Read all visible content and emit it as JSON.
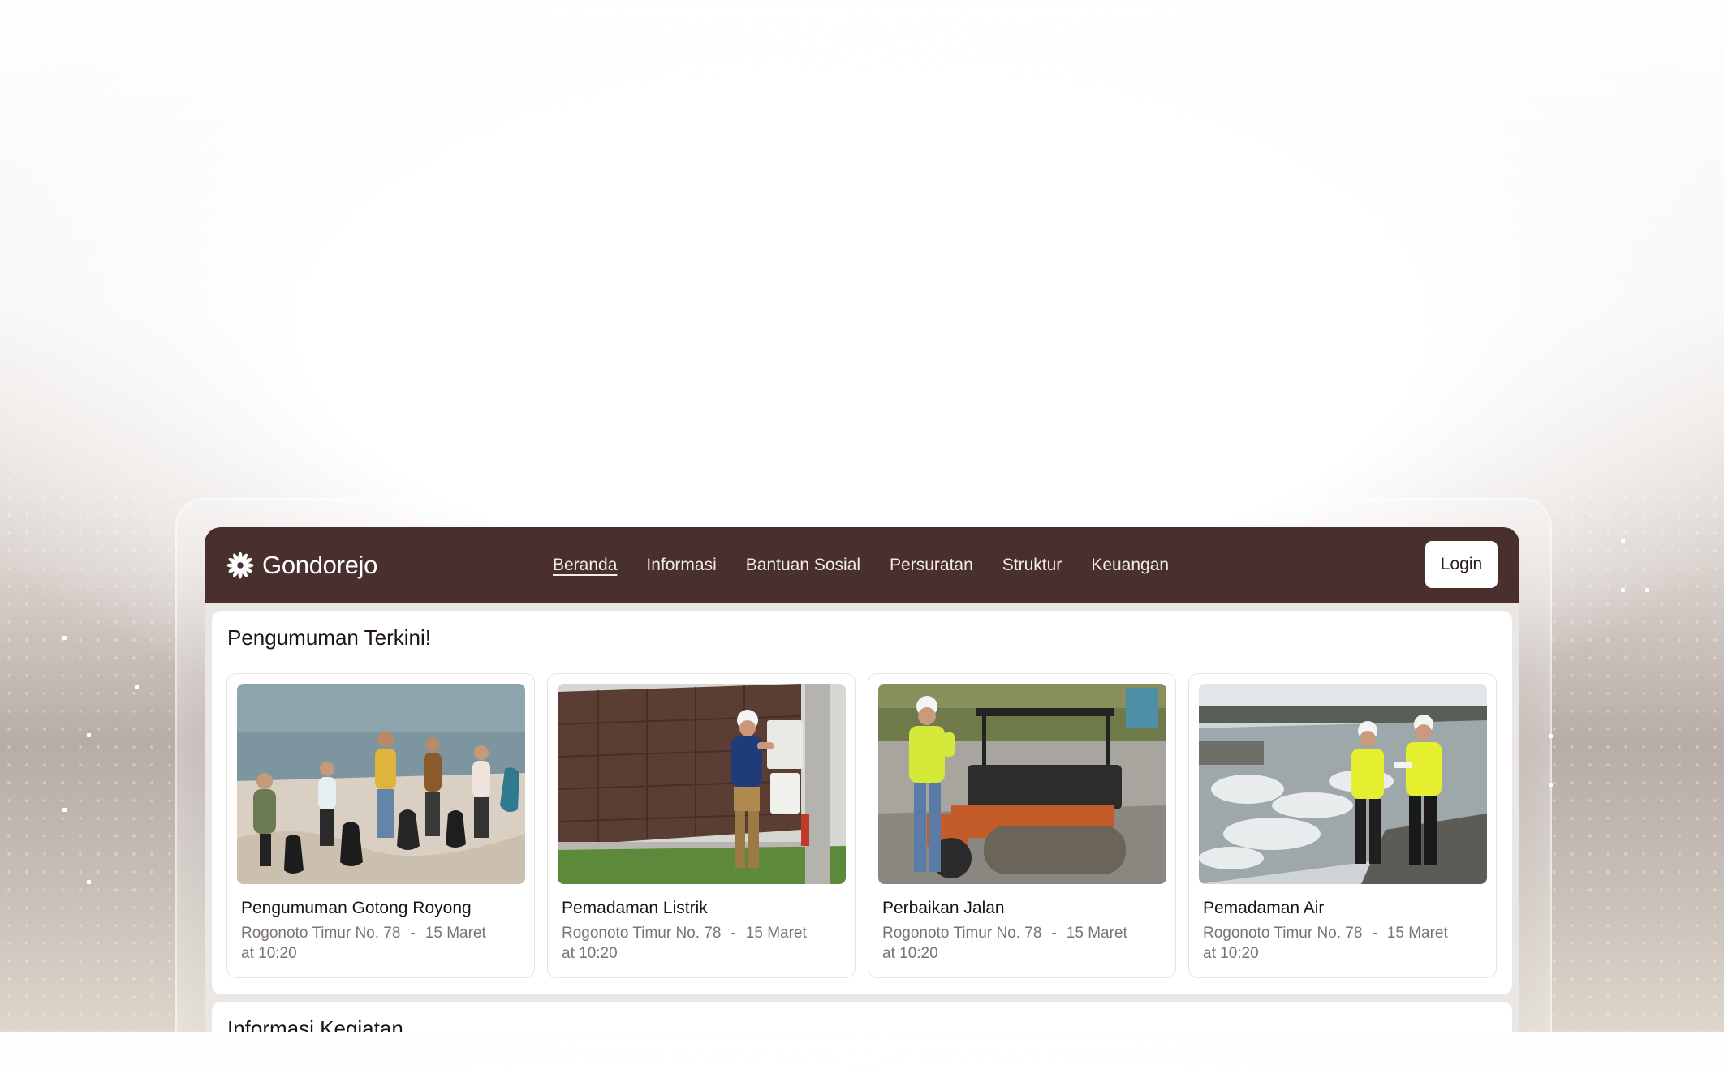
{
  "brand": {
    "name": "Gondorejo",
    "icon": "flower-logo-icon"
  },
  "nav": {
    "items": [
      {
        "label": "Beranda",
        "active": true
      },
      {
        "label": "Informasi",
        "active": false
      },
      {
        "label": "Bantuan Sosial",
        "active": false
      },
      {
        "label": "Persuratan",
        "active": false
      },
      {
        "label": "Struktur",
        "active": false
      },
      {
        "label": "Keuangan",
        "active": false
      }
    ],
    "login_label": "Login"
  },
  "announcements": {
    "title": "Pengumuman Terkini!",
    "cards": [
      {
        "title": "Pengumuman Gotong Royong",
        "location": "Rogonoto Timur No. 78",
        "separator": "-",
        "date": "15 Maret",
        "time": "at 10:20",
        "image": "beach-cleanup-photo"
      },
      {
        "title": "Pemadaman Listrik",
        "location": "Rogonoto Timur No. 78",
        "separator": "-",
        "date": "15 Maret",
        "time": "at 10:20",
        "image": "electrician-photo"
      },
      {
        "title": "Perbaikan Jalan",
        "location": "Rogonoto Timur No. 78",
        "separator": "-",
        "date": "15 Maret",
        "time": "at 10:20",
        "image": "road-roller-photo"
      },
      {
        "title": "Pemadaman Air",
        "location": "Rogonoto Timur No. 78",
        "separator": "-",
        "date": "15 Maret",
        "time": "at 10:20",
        "image": "water-inspection-photo"
      }
    ]
  },
  "activities": {
    "title": "Informasi Kegiatan"
  },
  "colors": {
    "navbar": "#4a2f2f",
    "accent_text": "#1e1414",
    "muted_text": "#7b7372"
  }
}
